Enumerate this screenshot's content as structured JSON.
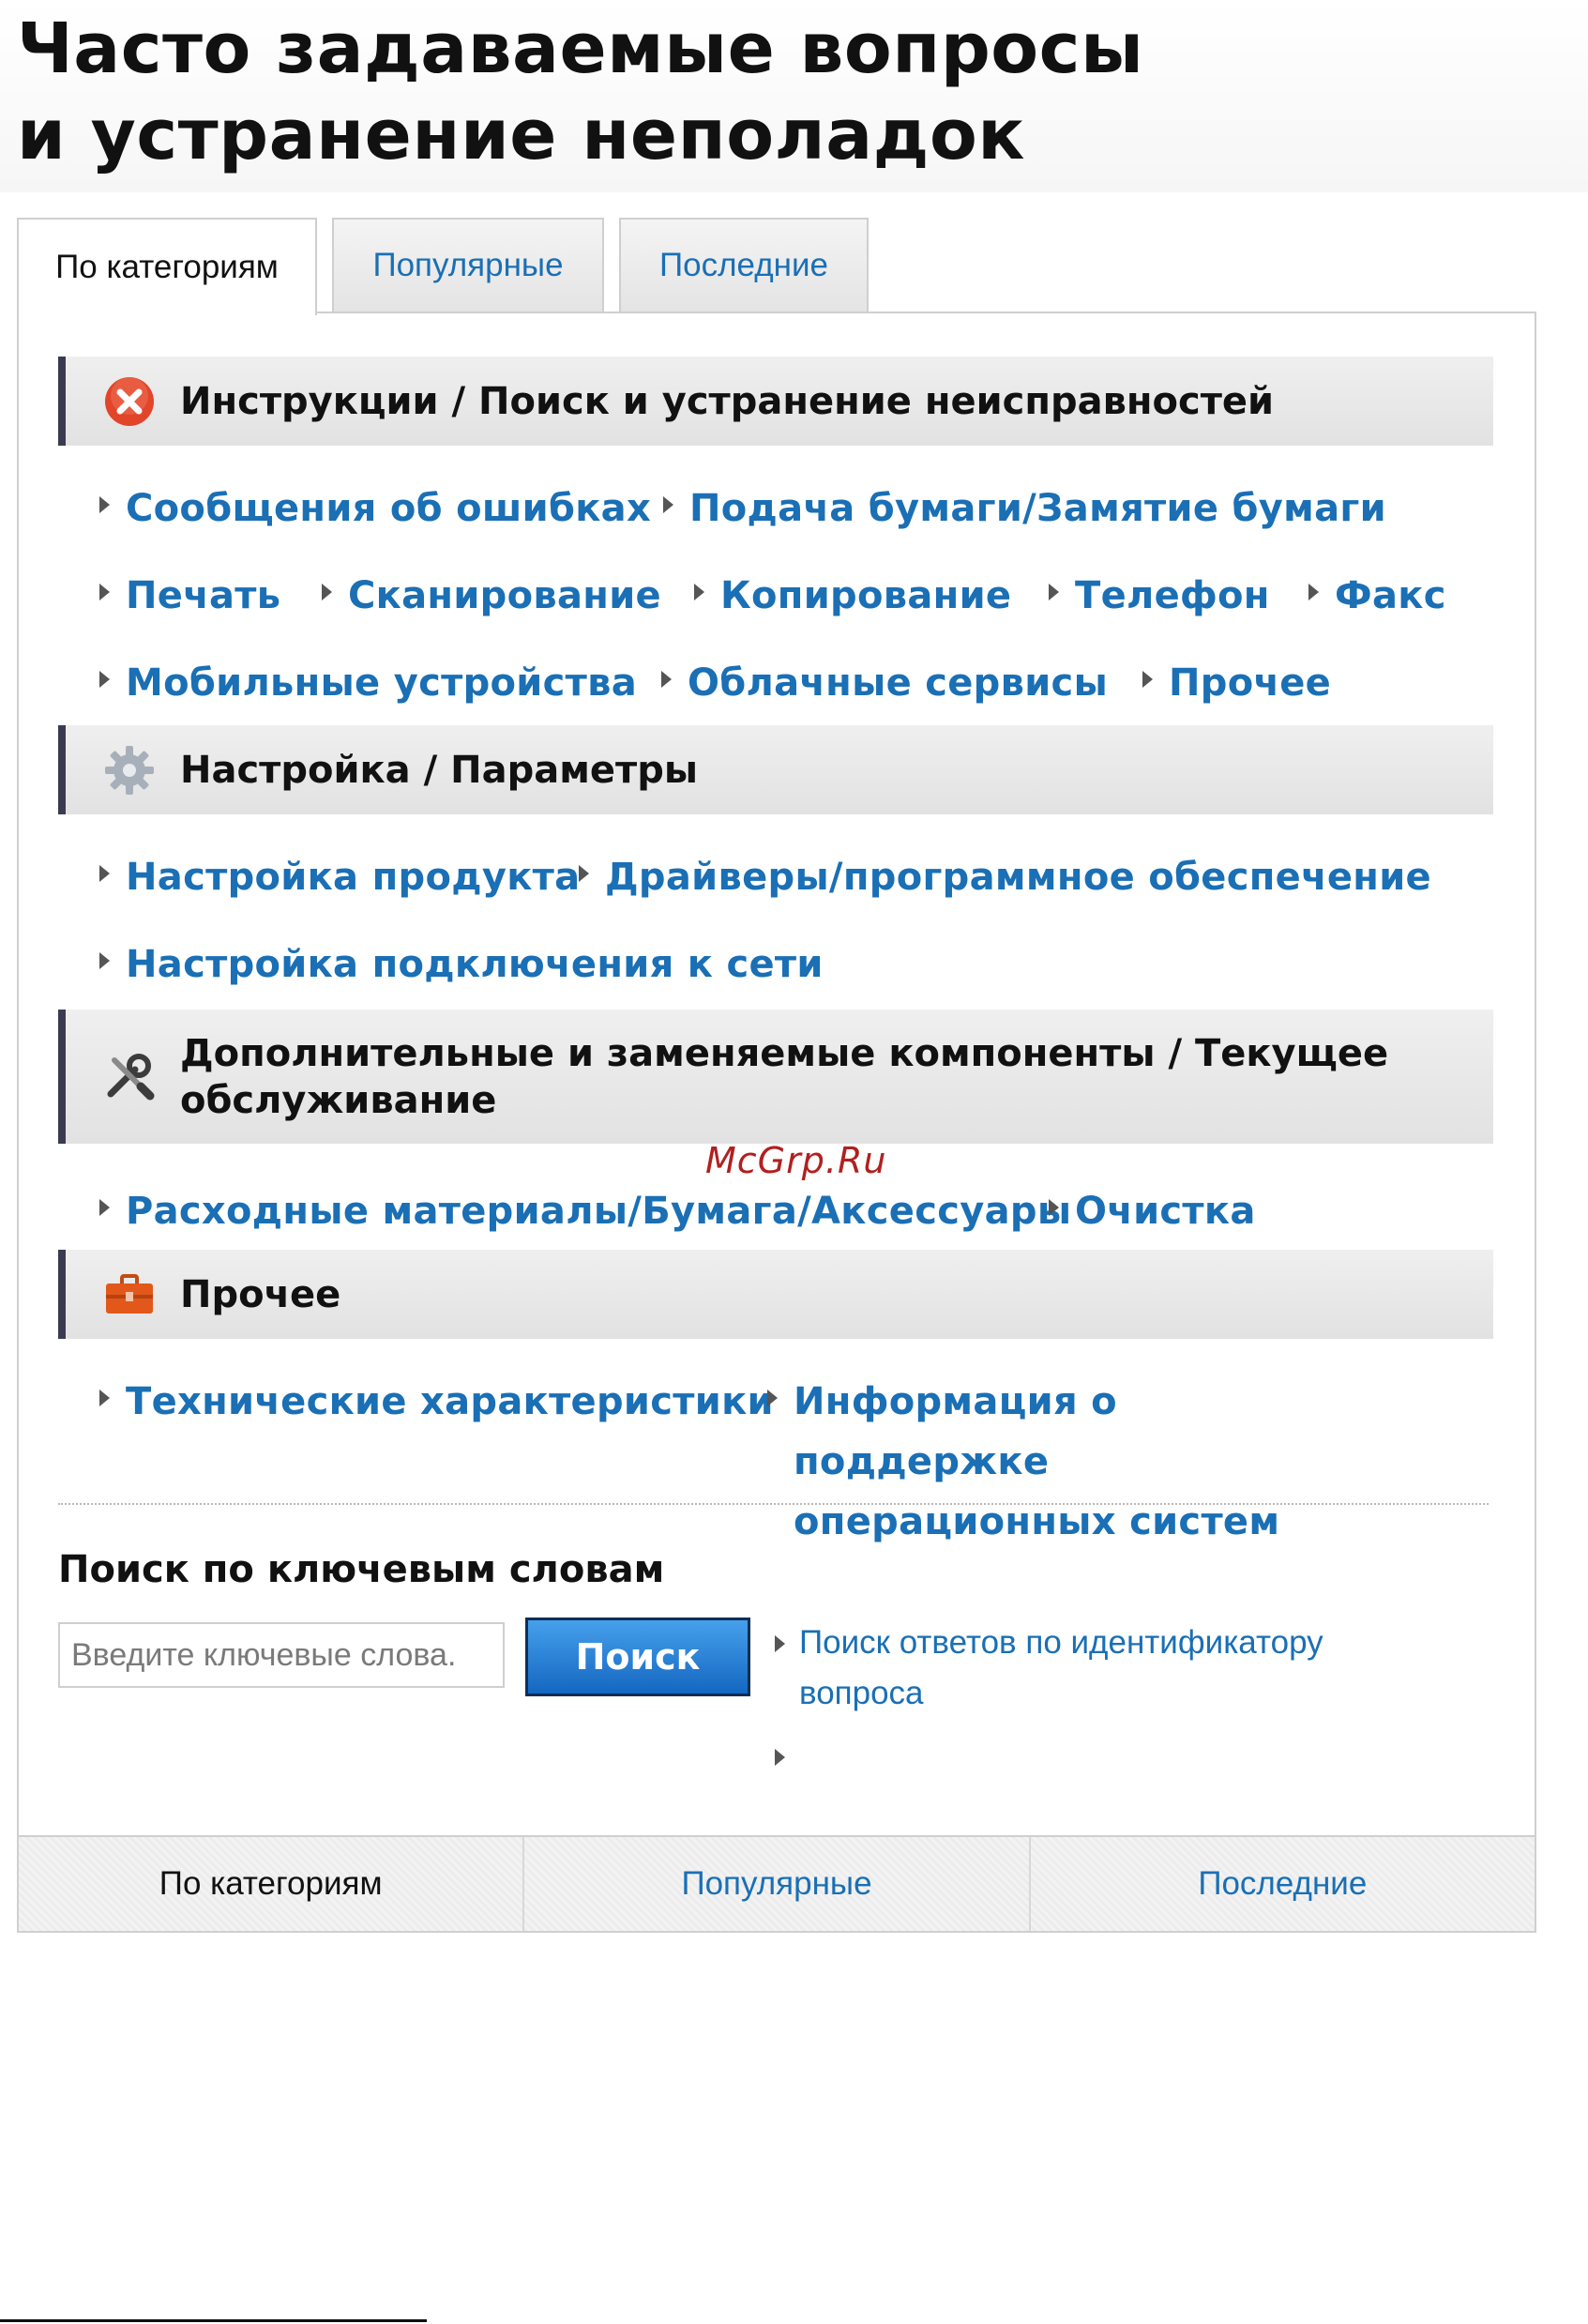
{
  "page": {
    "title": "Часто задаваемые вопросы\nи устранение неполадок"
  },
  "tabs": [
    {
      "label": "По категориям",
      "active": true
    },
    {
      "label": "Популярные",
      "active": false
    },
    {
      "label": "Последние",
      "active": false
    }
  ],
  "sections": [
    {
      "title": "Инструкции / Поиск и устранение неисправностей",
      "icon": "error-x-icon",
      "links": [
        "Сообщения об ошибках",
        "Подача бумаги/Замятие бумаги",
        "Печать",
        "Сканирование",
        "Копирование",
        "Телефон",
        "Факс",
        "Мобильные устройства",
        "Облачные сервисы",
        "Прочее"
      ]
    },
    {
      "title": "Настройка / Параметры",
      "icon": "gear-icon",
      "links": [
        "Настройка продукта",
        "Драйверы/программное обеспечение",
        "Настройка подключения к сети"
      ]
    },
    {
      "title": "Дополнительные и заменяемые компоненты / Текущее обслуживание",
      "icon": "tools-icon",
      "links": [
        "Расходные материалы/Бумага/Аксессуары",
        "Очистка"
      ]
    },
    {
      "title": "Прочее",
      "icon": "toolbox-icon",
      "links": [
        "Технические характеристики",
        "Информация о поддержке операционных систем"
      ]
    }
  ],
  "search": {
    "heading": "Поиск по ключевым словам",
    "placeholder": "Введите ключевые слова.",
    "button_label": "Поиск",
    "qid_link": "Поиск ответов по идентификатору вопроса"
  },
  "bottom_tabs": [
    {
      "label": "По категориям",
      "active": true
    },
    {
      "label": "Популярные",
      "active": false
    },
    {
      "label": "Последние",
      "active": false
    }
  ],
  "watermark": "McGrp.Ru",
  "colors": {
    "link": "#1a6fb5",
    "section_border": "#3a3a50",
    "button": "#1467c0",
    "error_icon": "#e2452a",
    "toolbox_icon": "#e2581b"
  }
}
